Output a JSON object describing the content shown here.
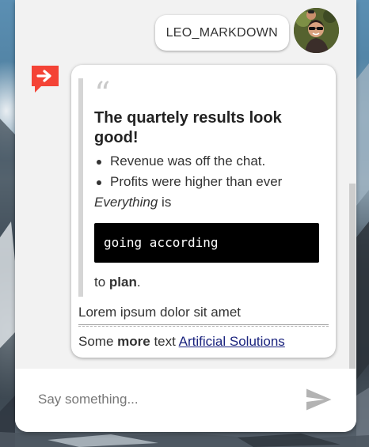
{
  "user_message": {
    "text": "LEO_MARKDOWN",
    "avatar_icon": "user-avatar-photo"
  },
  "bot_message": {
    "icon": "chat-arrow-icon",
    "icon_color": "#f44336",
    "quote_icon": "quote-mark-icon",
    "quote_heading": "The quartely results look good!",
    "bullets": [
      "Revenue was off the chat.",
      "Profits were higher than ever"
    ],
    "italic_word": "Everything",
    "italic_suffix": " is",
    "code": "going according",
    "plan_prefix": "to ",
    "plan_bold": "plan",
    "plan_suffix": ".",
    "lorem": "Lorem ipsum dolor sit amet",
    "footer_prefix": "Some ",
    "footer_bold": "more",
    "footer_middle": " text ",
    "footer_link": "Artificial Solutions"
  },
  "input": {
    "placeholder": "Say something...",
    "value": "",
    "send_icon": "send-icon"
  },
  "colors": {
    "panel_bg": "#f2f2f2",
    "link": "#1a237e",
    "code_bg": "#000000"
  }
}
